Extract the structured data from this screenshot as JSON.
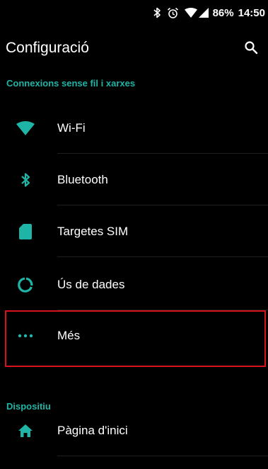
{
  "status_bar": {
    "battery_text": "86%",
    "time": "14:50",
    "icons": [
      "bluetooth-icon",
      "alarm-icon",
      "wifi-icon",
      "signal-icon"
    ]
  },
  "app_bar": {
    "title": "Configuració",
    "search_icon": "search-icon"
  },
  "sections": {
    "wireless": {
      "header": "Connexions sense fil i xarxes",
      "items": [
        {
          "label": "Wi-Fi",
          "icon": "wifi-icon"
        },
        {
          "label": "Bluetooth",
          "icon": "bluetooth-icon"
        },
        {
          "label": "Targetes SIM",
          "icon": "sim-card-icon"
        },
        {
          "label": "Ús de dades",
          "icon": "data-usage-icon"
        },
        {
          "label": "Més",
          "icon": "more-dots-icon"
        }
      ]
    },
    "device": {
      "header": "Dispositiu",
      "items": [
        {
          "label": "Pàgina d'inici",
          "icon": "home-icon"
        }
      ]
    }
  },
  "colors": {
    "accent": "#1fb5a6",
    "background": "#000000",
    "highlight": "#d6121b"
  }
}
